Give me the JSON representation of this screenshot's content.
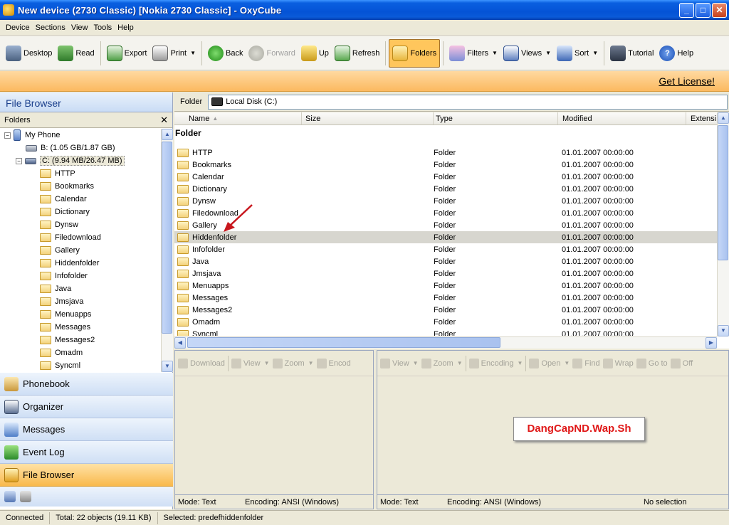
{
  "window": {
    "title": "New device (2730 Classic) [Nokia 2730 Classic] - OxyCube"
  },
  "menu": [
    "Device",
    "Sections",
    "View",
    "Tools",
    "Help"
  ],
  "toolbar": {
    "desktop": "Desktop",
    "read": "Read",
    "export": "Export",
    "print": "Print",
    "back": "Back",
    "forward": "Forward",
    "up": "Up",
    "refresh": "Refresh",
    "folders": "Folders",
    "filters": "Filters",
    "views": "Views",
    "sort": "Sort",
    "tutorial": "Tutorial",
    "help": "Help"
  },
  "license": {
    "link": "Get License!"
  },
  "left": {
    "header": "File Browser",
    "folders_label": "Folders",
    "tree": {
      "root": "My Phone",
      "drive_b": "B: (1.05 GB/1.87 GB)",
      "drive_c": "C: (9.94 MB/26.47 MB)",
      "children": [
        "HTTP",
        "Bookmarks",
        "Calendar",
        "Dictionary",
        "Dynsw",
        "Filedownload",
        "Gallery",
        "Hiddenfolder",
        "Infofolder",
        "Java",
        "Jmsjava",
        "Menuapps",
        "Messages",
        "Messages2",
        "Omadm",
        "Syncml"
      ]
    },
    "nav": [
      "Phonebook",
      "Organizer",
      "Messages",
      "Event Log",
      "File Browser"
    ]
  },
  "address": {
    "label": "Folder",
    "value": "Local Disk (C:)"
  },
  "list": {
    "columns": {
      "name": "Name",
      "size": "Size",
      "type": "Type",
      "modified": "Modified",
      "extension": "Extensi"
    },
    "group": "Folder",
    "rows": [
      {
        "name": "HTTP",
        "type": "Folder",
        "modified": "01.01.2007 00:00:00"
      },
      {
        "name": "Bookmarks",
        "type": "Folder",
        "modified": "01.01.2007 00:00:00"
      },
      {
        "name": "Calendar",
        "type": "Folder",
        "modified": "01.01.2007 00:00:00"
      },
      {
        "name": "Dictionary",
        "type": "Folder",
        "modified": "01.01.2007 00:00:00"
      },
      {
        "name": "Dynsw",
        "type": "Folder",
        "modified": "01.01.2007 00:00:00"
      },
      {
        "name": "Filedownload",
        "type": "Folder",
        "modified": "01.01.2007 00:00:00"
      },
      {
        "name": "Gallery",
        "type": "Folder",
        "modified": "01.01.2007 00:00:00"
      },
      {
        "name": "Hiddenfolder",
        "type": "Folder",
        "modified": "01.01.2007 00:00:00"
      },
      {
        "name": "Infofolder",
        "type": "Folder",
        "modified": "01.01.2007 00:00:00"
      },
      {
        "name": "Java",
        "type": "Folder",
        "modified": "01.01.2007 00:00:00"
      },
      {
        "name": "Jmsjava",
        "type": "Folder",
        "modified": "01.01.2007 00:00:00"
      },
      {
        "name": "Menuapps",
        "type": "Folder",
        "modified": "01.01.2007 00:00:00"
      },
      {
        "name": "Messages",
        "type": "Folder",
        "modified": "01.01.2007 00:00:00"
      },
      {
        "name": "Messages2",
        "type": "Folder",
        "modified": "01.01.2007 00:00:00"
      },
      {
        "name": "Omadm",
        "type": "Folder",
        "modified": "01.01.2007 00:00:00"
      },
      {
        "name": "Syncml",
        "type": "Folder",
        "modified": "01.01.2007 00:00:00"
      }
    ]
  },
  "lower_left": {
    "toolbar": {
      "download": "Download",
      "view": "View",
      "zoom": "Zoom",
      "encoding": "Encod"
    },
    "status": {
      "mode": "Mode: Text",
      "encoding": "Encoding: ANSI (Windows)"
    }
  },
  "lower_right": {
    "toolbar": {
      "view": "View",
      "zoom": "Zoom",
      "encoding": "Encoding",
      "open": "Open",
      "find": "Find",
      "wrap": "Wrap",
      "goto": "Go to",
      "off": "Off"
    },
    "status": {
      "mode": "Mode: Text",
      "encoding": "Encoding: ANSI (Windows)",
      "selection": "No selection"
    }
  },
  "watermark": "DangCapND.Wap.Sh",
  "status": {
    "connected": "Connected",
    "total": "Total: 22 objects (19.11 KB)",
    "selected": "Selected:  predefhiddenfolder"
  }
}
